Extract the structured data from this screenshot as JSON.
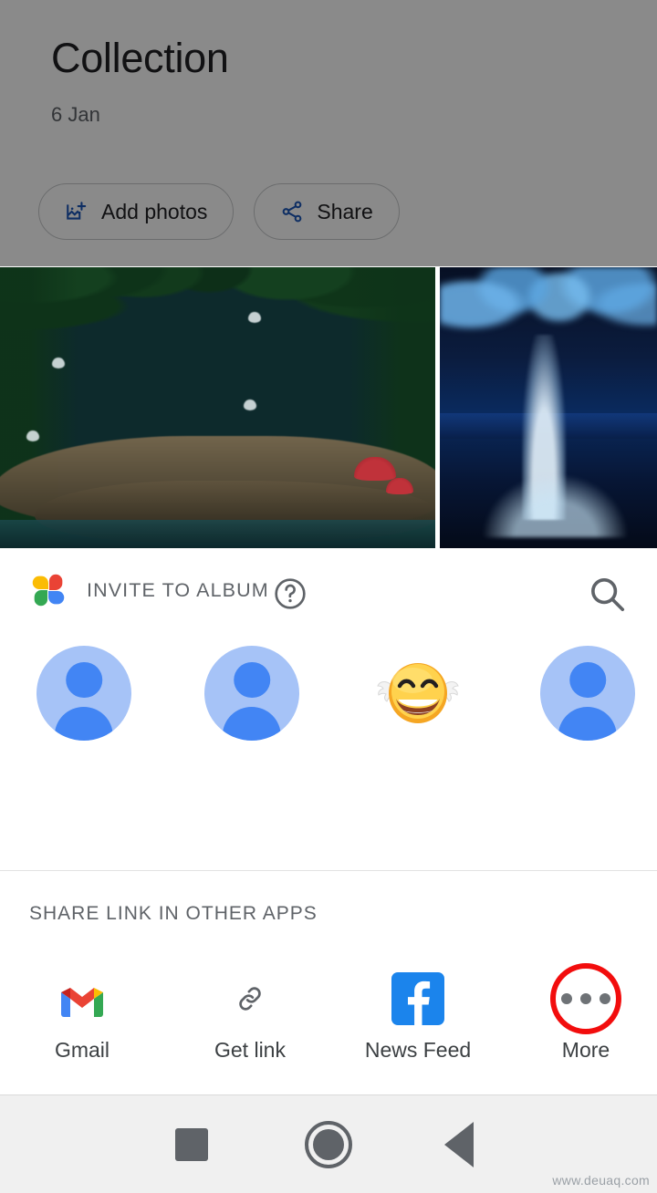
{
  "album": {
    "title": "Collection",
    "date": "6 Jan",
    "add_photos_label": "Add photos",
    "share_label": "Share",
    "photos": [
      {
        "alt": "Moonlit enchanted forest with fallen log and red mushrooms"
      },
      {
        "alt": "Blue illuminated water fountain at night"
      }
    ]
  },
  "sheet": {
    "title": "INVITE TO ALBUM",
    "help_icon": "help-circle-icon",
    "search_icon": "search-icon",
    "logo_icon": "google-photos-logo",
    "contacts": [
      {
        "name": "",
        "avatar_type": "person-placeholder"
      },
      {
        "name": "",
        "avatar_type": "person-placeholder"
      },
      {
        "name": "",
        "avatar_type": "emoji-grinning"
      },
      {
        "name": "",
        "avatar_type": "person-placeholder"
      }
    ],
    "apps_section_title": "SHARE LINK IN OTHER APPS",
    "apps": [
      {
        "label": "Gmail",
        "icon": "gmail-icon"
      },
      {
        "label": "Get link",
        "icon": "link-icon"
      },
      {
        "label": "News Feed",
        "icon": "facebook-icon"
      },
      {
        "label": "More",
        "icon": "more-horizontal-icon",
        "highlight_color": "#f20d0d"
      }
    ]
  },
  "navbar": {
    "recents_label": "Recents",
    "home_label": "Home",
    "back_label": "Back"
  },
  "watermark": "www.deuaq.com",
  "colors": {
    "accent_blue": "#1a73e8",
    "text_primary": "#202124",
    "text_secondary": "#5f6368",
    "highlight_red": "#f20d0d",
    "avatar_bg": "#a6c3f7",
    "avatar_fg": "#4285f4"
  }
}
